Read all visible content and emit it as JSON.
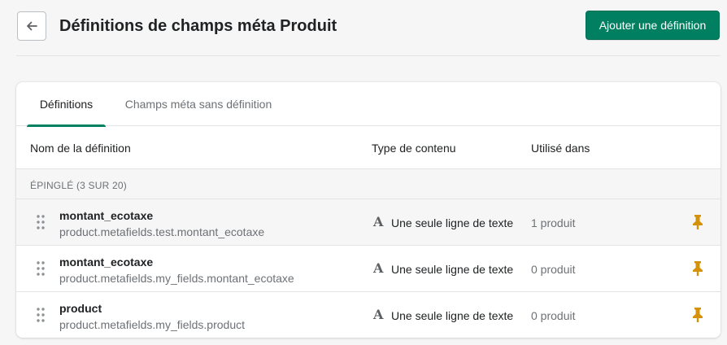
{
  "header": {
    "title": "Définitions de champs méta Produit",
    "add_button_label": "Ajouter une définition"
  },
  "tabs": [
    {
      "label": "Définitions",
      "active": true
    },
    {
      "label": "Champs méta sans définition",
      "active": false
    }
  ],
  "columns": {
    "name": "Nom de la définition",
    "type": "Type de contenu",
    "used_in": "Utilisé dans"
  },
  "section": {
    "label": "ÉPINGLÉ (3 SUR 20)"
  },
  "rows": [
    {
      "name": "montant_ecotaxe",
      "key": "product.metafields.test.montant_ecotaxe",
      "type": "Une seule ligne de texte",
      "usage": "1 produit"
    },
    {
      "name": "montant_ecotaxe",
      "key": "product.metafields.my_fields.montant_ecotaxe",
      "type": "Une seule ligne de texte",
      "usage": "0 produit"
    },
    {
      "name": "product",
      "key": "product.metafields.my_fields.product",
      "type": "Une seule ligne de texte",
      "usage": "0 produit"
    }
  ],
  "icons": {
    "back": "arrow-left-icon",
    "drag": "drag-handle-icon",
    "type": "text-type-icon",
    "pin": "pin-icon"
  },
  "colors": {
    "primary": "#008060",
    "pin": "#d4920b"
  }
}
